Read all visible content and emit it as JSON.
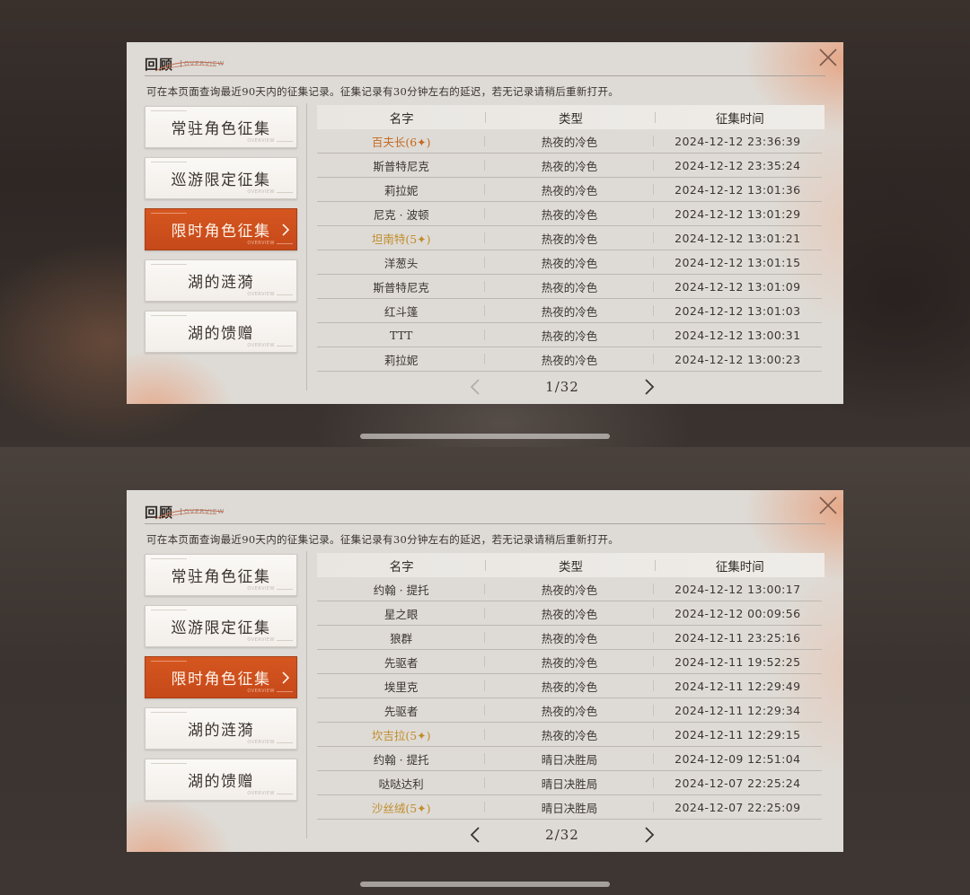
{
  "panels": [
    {
      "title": "回顾",
      "subtitle": "OVERVIEW",
      "notice": "可在本页面查询最近90天内的征集记录。征集记录有30分钟左右的延迟，若无记录请稍后重新打开。",
      "sidebar": [
        {
          "label": "常驻角色征集",
          "tag": "OVERVIEW",
          "active": false
        },
        {
          "label": "巡游限定征集",
          "tag": "OVERVIEW",
          "active": false
        },
        {
          "label": "限时角色征集",
          "tag": "OVERVIEW",
          "active": true
        },
        {
          "label": "湖的涟漪",
          "tag": "OVERVIEW",
          "active": false
        },
        {
          "label": "湖的馈赠",
          "tag": "OVERVIEW",
          "active": false
        }
      ],
      "table": {
        "headers": [
          "名字",
          "类型",
          "征集时间"
        ],
        "rows": [
          {
            "name": "百夫长(6✦)",
            "type": "热夜的冷色",
            "time": "2024-12-12 23:36:39",
            "rarity": "6"
          },
          {
            "name": "斯普特尼克",
            "type": "热夜的冷色",
            "time": "2024-12-12 23:35:24",
            "rarity": ""
          },
          {
            "name": "莉拉妮",
            "type": "热夜的冷色",
            "time": "2024-12-12 13:01:36",
            "rarity": ""
          },
          {
            "name": "尼克 · 波顿",
            "type": "热夜的冷色",
            "time": "2024-12-12 13:01:29",
            "rarity": ""
          },
          {
            "name": "坦南特(5✦)",
            "type": "热夜的冷色",
            "time": "2024-12-12 13:01:21",
            "rarity": "5"
          },
          {
            "name": "洋葱头",
            "type": "热夜的冷色",
            "time": "2024-12-12 13:01:15",
            "rarity": ""
          },
          {
            "name": "斯普特尼克",
            "type": "热夜的冷色",
            "time": "2024-12-12 13:01:09",
            "rarity": ""
          },
          {
            "name": "红斗篷",
            "type": "热夜的冷色",
            "time": "2024-12-12 13:01:03",
            "rarity": ""
          },
          {
            "name": "TTT",
            "type": "热夜的冷色",
            "time": "2024-12-12 13:00:31",
            "rarity": ""
          },
          {
            "name": "莉拉妮",
            "type": "热夜的冷色",
            "time": "2024-12-12 13:00:23",
            "rarity": ""
          }
        ]
      },
      "page": "1/32",
      "prev_enabled": false
    },
    {
      "title": "回顾",
      "subtitle": "OVERVIEW",
      "notice": "可在本页面查询最近90天内的征集记录。征集记录有30分钟左右的延迟，若无记录请稍后重新打开。",
      "sidebar": [
        {
          "label": "常驻角色征集",
          "tag": "OVERVIEW",
          "active": false
        },
        {
          "label": "巡游限定征集",
          "tag": "OVERVIEW",
          "active": false
        },
        {
          "label": "限时角色征集",
          "tag": "OVERVIEW",
          "active": true
        },
        {
          "label": "湖的涟漪",
          "tag": "OVERVIEW",
          "active": false
        },
        {
          "label": "湖的馈赠",
          "tag": "OVERVIEW",
          "active": false
        }
      ],
      "table": {
        "headers": [
          "名字",
          "类型",
          "征集时间"
        ],
        "rows": [
          {
            "name": "约翰 · 提托",
            "type": "热夜的冷色",
            "time": "2024-12-12 13:00:17",
            "rarity": ""
          },
          {
            "name": "星之眼",
            "type": "热夜的冷色",
            "time": "2024-12-12 00:09:56",
            "rarity": ""
          },
          {
            "name": "狼群",
            "type": "热夜的冷色",
            "time": "2024-12-11 23:25:16",
            "rarity": ""
          },
          {
            "name": "先驱者",
            "type": "热夜的冷色",
            "time": "2024-12-11 19:52:25",
            "rarity": ""
          },
          {
            "name": "埃里克",
            "type": "热夜的冷色",
            "time": "2024-12-11 12:29:49",
            "rarity": ""
          },
          {
            "name": "先驱者",
            "type": "热夜的冷色",
            "time": "2024-12-11 12:29:34",
            "rarity": ""
          },
          {
            "name": "坎吉拉(5✦)",
            "type": "热夜的冷色",
            "time": "2024-12-11 12:29:15",
            "rarity": "5"
          },
          {
            "name": "约翰 · 提托",
            "type": "晴日决胜局",
            "time": "2024-12-09 12:51:04",
            "rarity": ""
          },
          {
            "name": "哒哒达利",
            "type": "晴日决胜局",
            "time": "2024-12-07 22:25:24",
            "rarity": ""
          },
          {
            "name": "沙丝绒(5✦)",
            "type": "晴日决胜局",
            "time": "2024-12-07 22:25:09",
            "rarity": "5"
          }
        ]
      },
      "page": "2/32",
      "prev_enabled": true
    }
  ],
  "colors": {
    "accent": "#d5561f",
    "rarity6": "#c46a22",
    "rarity5": "#c08c2c",
    "panel_bg": "#dedbd6"
  },
  "icons": {
    "close": "close-icon",
    "chevron_right": "chevron-right-icon",
    "prev": "arrow-left-icon",
    "next": "arrow-right-icon"
  }
}
